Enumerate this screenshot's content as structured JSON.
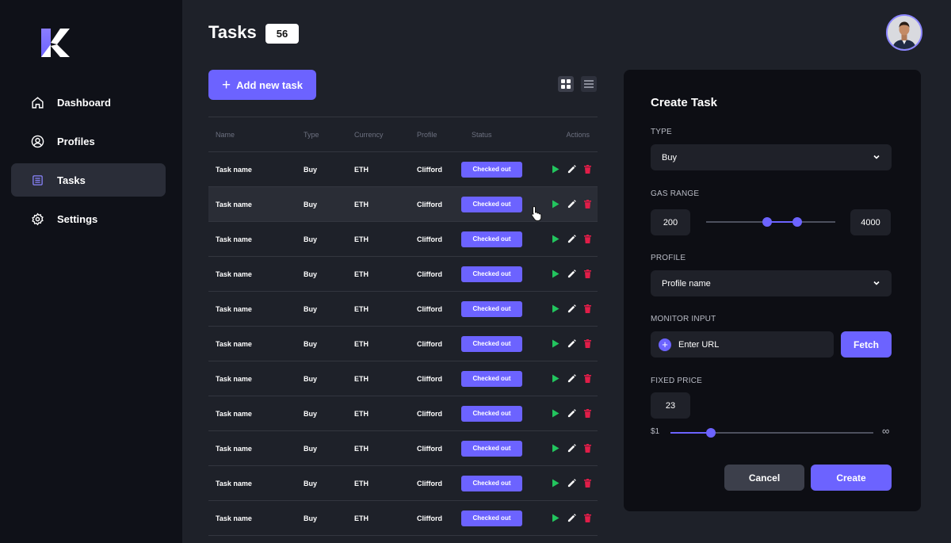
{
  "sidebar": {
    "items": [
      {
        "label": "Dashboard",
        "icon": "home-icon"
      },
      {
        "label": "Profiles",
        "icon": "user-circle-icon"
      },
      {
        "label": "Tasks",
        "icon": "list-icon"
      },
      {
        "label": "Settings",
        "icon": "gear-icon"
      }
    ],
    "active": "Tasks"
  },
  "header": {
    "title": "Tasks",
    "count": "56",
    "add_button": "Add new task"
  },
  "table": {
    "columns": [
      "Name",
      "Type",
      "Currency",
      "Profile",
      "Status",
      "Actions"
    ],
    "rows": [
      {
        "name": "Task name",
        "type": "Buy",
        "currency": "ETH",
        "profile": "Clifford",
        "status": "Checked out"
      },
      {
        "name": "Task name",
        "type": "Buy",
        "currency": "ETH",
        "profile": "Clifford",
        "status": "Checked out"
      },
      {
        "name": "Task name",
        "type": "Buy",
        "currency": "ETH",
        "profile": "Clifford",
        "status": "Checked out"
      },
      {
        "name": "Task name",
        "type": "Buy",
        "currency": "ETH",
        "profile": "Clifford",
        "status": "Checked out"
      },
      {
        "name": "Task name",
        "type": "Buy",
        "currency": "ETH",
        "profile": "Clifford",
        "status": "Checked out"
      },
      {
        "name": "Task name",
        "type": "Buy",
        "currency": "ETH",
        "profile": "Clifford",
        "status": "Checked out"
      },
      {
        "name": "Task name",
        "type": "Buy",
        "currency": "ETH",
        "profile": "Clifford",
        "status": "Checked out"
      },
      {
        "name": "Task name",
        "type": "Buy",
        "currency": "ETH",
        "profile": "Clifford",
        "status": "Checked out"
      },
      {
        "name": "Task name",
        "type": "Buy",
        "currency": "ETH",
        "profile": "Clifford",
        "status": "Checked out"
      },
      {
        "name": "Task name",
        "type": "Buy",
        "currency": "ETH",
        "profile": "Clifford",
        "status": "Checked out"
      },
      {
        "name": "Task name",
        "type": "Buy",
        "currency": "ETH",
        "profile": "Clifford",
        "status": "Checked out"
      }
    ]
  },
  "create_task": {
    "title": "Create Task",
    "type_label": "TYPE",
    "type_value": "Buy",
    "gas_label": "GAS RANGE",
    "gas_min": "200",
    "gas_max": "4000",
    "profile_label": "PROFILE",
    "profile_value": "Profile name",
    "monitor_label": "MONITOR INPUT",
    "monitor_placeholder": "Enter URL",
    "fetch_label": "Fetch",
    "fixed_price_label": "FIXED PRICE",
    "fixed_price_value": "23",
    "price_min_label": "$1",
    "price_max_label": "∞",
    "cancel_label": "Cancel",
    "create_label": "Create"
  },
  "colors": {
    "accent": "#6c63ff",
    "play": "#22c55e",
    "delete": "#e11d48",
    "background": "#1e2129",
    "sidebar": "#0f1118",
    "panel": "#0d0e14"
  }
}
